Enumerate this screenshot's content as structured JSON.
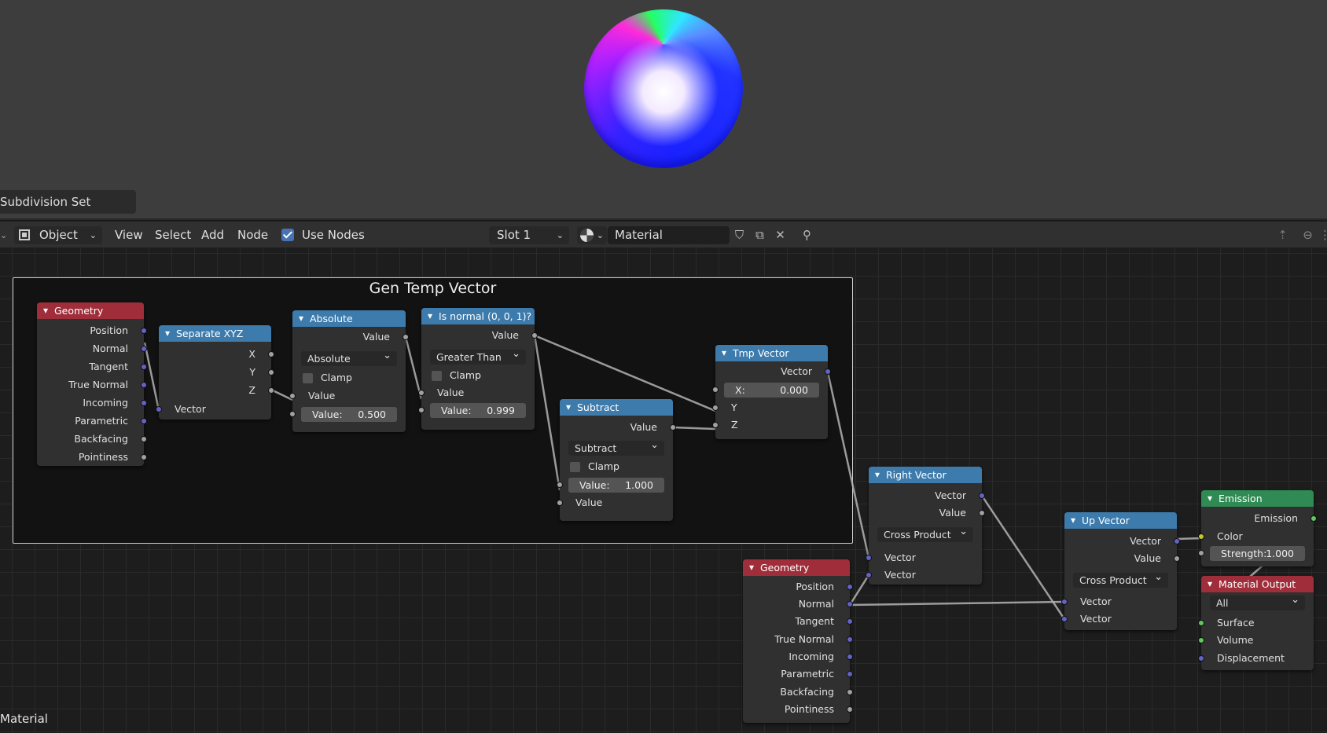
{
  "viewport": {
    "panel_label": "Subdivision Set"
  },
  "header": {
    "mode": "Object",
    "menus": [
      "View",
      "Select",
      "Add",
      "Node"
    ],
    "use_nodes_label": "Use Nodes",
    "use_nodes_checked": true,
    "slot": "Slot 1",
    "material_name": "Material"
  },
  "frame": {
    "title": "Gen Temp Vector"
  },
  "nodes": {
    "geometry1": {
      "title": "Geometry",
      "outputs": [
        "Position",
        "Normal",
        "Tangent",
        "True Normal",
        "Incoming",
        "Parametric",
        "Backfacing",
        "Pointiness"
      ]
    },
    "separate": {
      "title": "Separate XYZ",
      "outputs": [
        "X",
        "Y",
        "Z"
      ],
      "input": "Vector"
    },
    "absolute": {
      "title": "Absolute",
      "output": "Value",
      "operation": "Absolute",
      "clamp": "Clamp",
      "input": "Value",
      "field_label": "Value:",
      "field_value": "0.500"
    },
    "isnormal": {
      "title": "Is normal (0, 0, 1)?",
      "output": "Value",
      "operation": "Greater Than",
      "clamp": "Clamp",
      "input": "Value",
      "field_label": "Value:",
      "field_value": "0.999"
    },
    "subtract": {
      "title": "Subtract",
      "output": "Value",
      "operation": "Subtract",
      "clamp": "Clamp",
      "field_label": "Value:",
      "field_value": "1.000",
      "input": "Value"
    },
    "tmp": {
      "title": "Tmp Vector",
      "output": "Vector",
      "x_label": "X:",
      "x_value": "0.000",
      "y": "Y",
      "z": "Z"
    },
    "right": {
      "title": "Right Vector",
      "outputs": [
        "Vector",
        "Value"
      ],
      "operation": "Cross Product",
      "inputs": [
        "Vector",
        "Vector"
      ]
    },
    "geometry2": {
      "title": "Geometry",
      "outputs": [
        "Position",
        "Normal",
        "Tangent",
        "True Normal",
        "Incoming",
        "Parametric",
        "Backfacing",
        "Pointiness"
      ]
    },
    "up": {
      "title": "Up Vector",
      "outputs": [
        "Vector",
        "Value"
      ],
      "operation": "Cross Product",
      "inputs": [
        "Vector",
        "Vector"
      ]
    },
    "emission": {
      "title": "Emission",
      "output": "Emission",
      "color_label": "Color",
      "strength_label": "Strength:",
      "strength_value": "1.000"
    },
    "matout": {
      "title": "Material Output",
      "target": "All",
      "inputs": [
        "Surface",
        "Volume",
        "Displacement"
      ]
    }
  },
  "footer": {
    "material_label": "Material"
  },
  "colors": {
    "vector_socket": "#6363c7",
    "value_socket": "#a1a1a1",
    "color_socket": "#c7c729",
    "shader_socket": "#63c763",
    "input_header": "#a02e3a",
    "converter_header": "#3d7bac",
    "shader_header": "#2f8a53"
  }
}
